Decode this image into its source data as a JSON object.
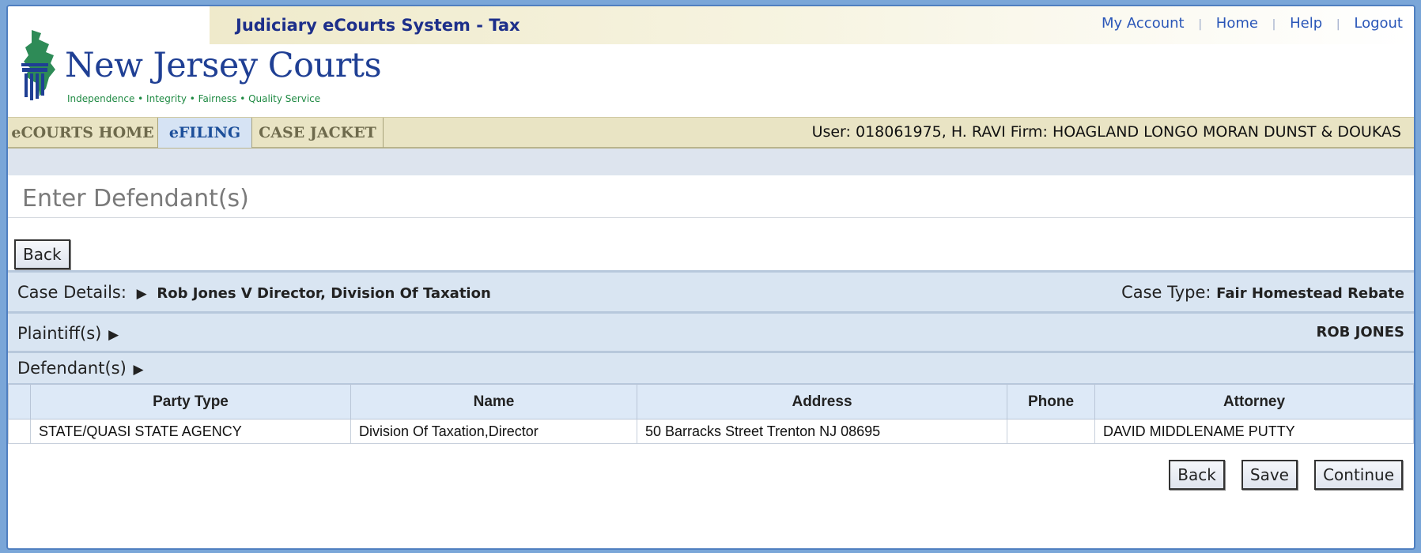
{
  "header": {
    "app_title": "Judiciary eCourts System - Tax",
    "links": [
      "My Account",
      "Home",
      "Help",
      "Logout"
    ],
    "logo_name": "New Jersey Courts",
    "logo_tagline": "Independence • Integrity • Fairness • Quality Service"
  },
  "nav": {
    "tabs": [
      "eCOURTS HOME",
      "eFILING",
      "CASE JACKET"
    ],
    "active_tab": "eFILING",
    "user_info": "User: 018061975, H. RAVI  Firm: HOAGLAND LONGO MORAN DUNST & DOUKAS"
  },
  "page": {
    "title": "Enter Defendant(s)",
    "back_label": "Back"
  },
  "case_details": {
    "label": "Case Details:",
    "value": "Rob Jones V Director, Division Of Taxation",
    "case_type_label": "Case Type:",
    "case_type_value": "Fair Homestead Rebate"
  },
  "plaintiffs": {
    "label": "Plaintiff(s)",
    "value": "ROB JONES"
  },
  "defendants": {
    "label": "Defendant(s)",
    "columns": [
      "",
      "Party Type",
      "Name",
      "Address",
      "Phone",
      "Attorney"
    ],
    "rows": [
      {
        "party_type": "STATE/QUASI STATE AGENCY",
        "name": "Division Of Taxation,Director",
        "address": "50 Barracks Street Trenton NJ 08695",
        "phone": "",
        "attorney": "DAVID MIDDLENAME PUTTY"
      }
    ]
  },
  "actions": {
    "back": "Back",
    "save": "Save",
    "continue": "Continue"
  },
  "colors": {
    "title_blue": "#1d2f8a",
    "link_blue": "#2a56b8",
    "nav_bg": "#e9e4c4",
    "active_tab_bg": "#d6e3f4",
    "section_bg": "#d9e5f2",
    "logo_green": "#1f8a43"
  },
  "icons": [
    "nj-courts-logo-icon",
    "triangle-right-icon"
  ]
}
